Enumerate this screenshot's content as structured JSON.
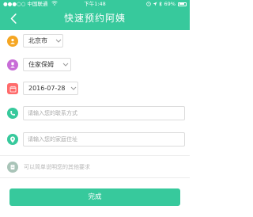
{
  "status_bar": {
    "carrier": "●●●○○ 中国联通",
    "wifi_icon": "wifi-icon",
    "time": "下午1:48",
    "battery_percent": "69%",
    "battery_level": 0.69
  },
  "header": {
    "title": "快速预约阿姨",
    "back_icon": "back-arrow-icon",
    "color": "#37c99c"
  },
  "form": {
    "city": {
      "value": "北京市",
      "icon": "location-person-icon",
      "icon_color": "#f5a623"
    },
    "service": {
      "value": "住家保姆",
      "icon": "worker-icon",
      "icon_color": "#c86dd7"
    },
    "date": {
      "value": "2016-07-28",
      "icon": "calendar-icon",
      "icon_color": "#ff6b6b"
    },
    "phone": {
      "placeholder": "请输入您的联系方式",
      "icon": "phone-icon",
      "icon_color": "#37c99c"
    },
    "address": {
      "placeholder": "请输入您的家庭住址",
      "icon": "map-pin-icon",
      "icon_color": "#37c99c"
    },
    "remark": {
      "placeholder": "可以简单说明您的其他要求",
      "icon": "note-icon",
      "icon_color": "#a9c4b8"
    }
  },
  "submit_label": "完成"
}
